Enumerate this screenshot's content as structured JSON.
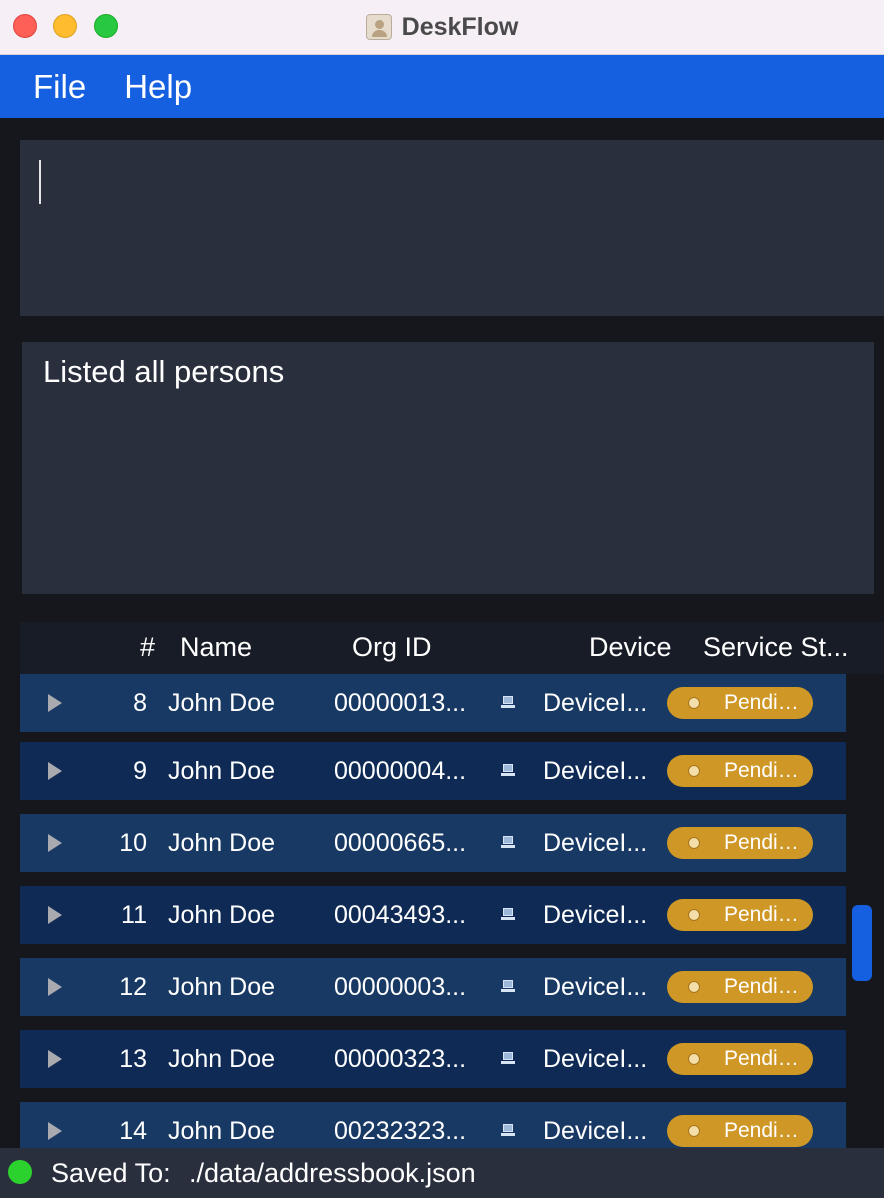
{
  "window": {
    "title": "DeskFlow",
    "app_icon": "address-book-icon"
  },
  "menu": {
    "items": [
      "File",
      "Help"
    ]
  },
  "command_box": {
    "value": "",
    "placeholder": ""
  },
  "result_display": {
    "text": "Listed all persons"
  },
  "table": {
    "columns": [
      "#",
      "Name",
      "Org ID",
      "Device",
      "Service St..."
    ],
    "rows": [
      {
        "index": "8",
        "name": "John Doe",
        "org_id": "00000013...",
        "device": "DeviceI...",
        "status": "Pendin..."
      },
      {
        "index": "9",
        "name": "John Doe",
        "org_id": "00000004...",
        "device": "DeviceI...",
        "status": "Pendin..."
      },
      {
        "index": "10",
        "name": "John Doe",
        "org_id": "00000665...",
        "device": "DeviceI...",
        "status": "Pendin..."
      },
      {
        "index": "11",
        "name": "John Doe",
        "org_id": "00043493...",
        "device": "DeviceI...",
        "status": "Pendin..."
      },
      {
        "index": "12",
        "name": "John Doe",
        "org_id": "00000003...",
        "device": "DeviceI...",
        "status": "Pendin..."
      },
      {
        "index": "13",
        "name": "John Doe",
        "org_id": "00000323...",
        "device": "DeviceI...",
        "status": "Pendin..."
      },
      {
        "index": "14",
        "name": "John Doe",
        "org_id": "00232323...",
        "device": "DeviceI...",
        "status": "Pendin..."
      }
    ]
  },
  "status_bar": {
    "label": "Saved To:",
    "path": "./data/addressbook.json"
  },
  "colors": {
    "menubar": "#1560e0",
    "panel": "#292f3d",
    "row": "#183963",
    "row_alt": "#0f2b55",
    "badge_pending": "#cf9726",
    "status_ok": "#2bd22d"
  }
}
